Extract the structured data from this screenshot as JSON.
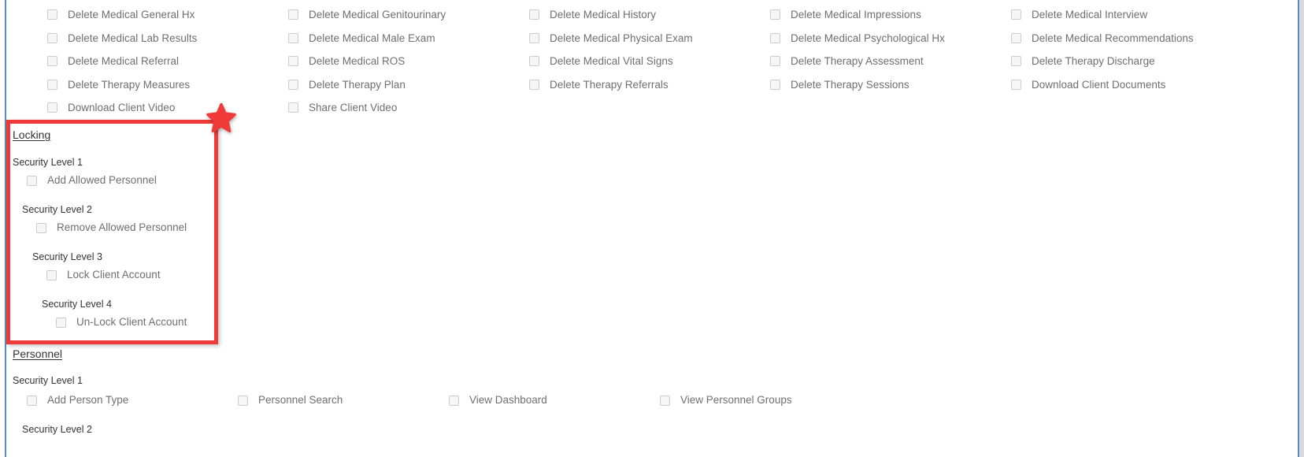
{
  "permission_grid": {
    "rows": [
      [
        "Delete Medical General Hx",
        "Delete Medical Genitourinary",
        "Delete Medical History",
        "Delete Medical Impressions",
        "Delete Medical Interview"
      ],
      [
        "Delete Medical Lab Results",
        "Delete Medical Male Exam",
        "Delete Medical Physical Exam",
        "Delete Medical Psychological Hx",
        "Delete Medical Recommendations"
      ],
      [
        "Delete Medical Referral",
        "Delete Medical ROS",
        "Delete Medical Vital Signs",
        "Delete Therapy Assessment",
        "Delete Therapy Discharge"
      ],
      [
        "Delete Therapy Measures",
        "Delete Therapy Plan",
        "Delete Therapy Referrals",
        "Delete Therapy Sessions",
        "Download Client Documents"
      ],
      [
        "Download Client Video",
        "Share Client Video",
        "",
        "",
        ""
      ]
    ]
  },
  "locking": {
    "title": "Locking",
    "levels": [
      {
        "label": "Security Level 1",
        "items": [
          "Add Allowed Personnel"
        ]
      },
      {
        "label": "Security Level 2",
        "items": [
          "Remove Allowed Personnel"
        ]
      },
      {
        "label": "Security Level 3",
        "items": [
          "Lock Client Account"
        ]
      },
      {
        "label": "Security Level 4",
        "items": [
          "Un-Lock Client Account"
        ]
      }
    ]
  },
  "personnel": {
    "title": "Personnel",
    "levels": [
      {
        "label": "Security Level 1",
        "items": [
          "Add Person Type",
          "Personnel Search",
          "View Dashboard",
          "View Personnel Groups"
        ]
      },
      {
        "label": "Security Level 2",
        "items": []
      }
    ]
  },
  "annotation": {
    "star_color": "#f03a3a",
    "box_color": "#f03a3a",
    "shape": "five-pointed-star"
  },
  "colors": {
    "accent_blue": "#5b8bbf",
    "label_text": "#6f6f6f",
    "heading_text": "#333333",
    "checkbox_border": "#cccccc",
    "checkbox_fill": "#f6f6f6",
    "background": "#ffffff"
  }
}
